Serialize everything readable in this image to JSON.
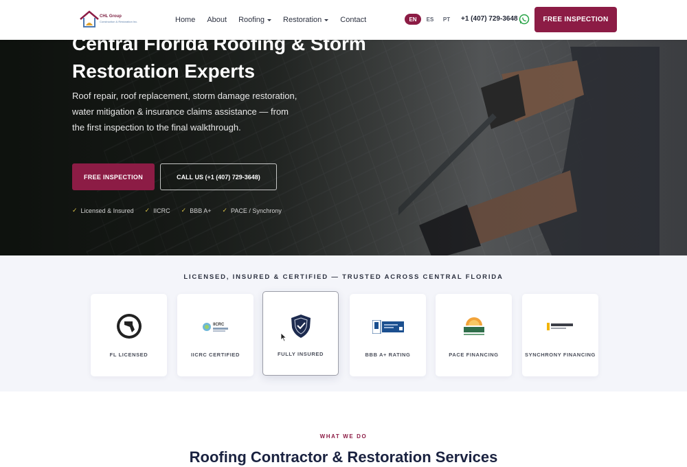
{
  "brand": {
    "logo_name": "CHL Group",
    "logo_subtitle": "Construction & Restoration Inc.",
    "primary_color": "#8c1c45"
  },
  "nav": {
    "items": [
      {
        "label": "Home",
        "has_dropdown": false
      },
      {
        "label": "About",
        "has_dropdown": false
      },
      {
        "label": "Roofing",
        "has_dropdown": true
      },
      {
        "label": "Restoration",
        "has_dropdown": true
      },
      {
        "label": "Contact",
        "has_dropdown": false
      }
    ]
  },
  "languages": {
    "options": [
      "EN",
      "ES",
      "PT"
    ],
    "selected": "EN"
  },
  "header": {
    "phone": "+1 (407) 729-3648",
    "whatsapp_icon": "whatsapp-icon",
    "cta_label": "FREE INSPECTION"
  },
  "hero": {
    "title": "Central Florida Roofing & Storm Restoration Experts",
    "subtitle": "Roof repair, roof replacement, storm damage restoration, water mitigation & insurance claims assistance — from the first inspection to the final walkthrough.",
    "primary_cta": "FREE INSPECTION",
    "secondary_cta": "CALL US (+1 (407) 729-3648)",
    "badges": [
      "Licensed & Insured",
      "IICRC",
      "BBB A+",
      "PACE / Synchrony"
    ]
  },
  "trust": {
    "heading": "LICENSED, INSURED & CERTIFIED — TRUSTED ACROSS CENTRAL FLORIDA",
    "cards": [
      {
        "label": "FL LICENSED",
        "icon": "florida-seal-icon"
      },
      {
        "label": "IICRC CERTIFIED",
        "icon": "iicrc-logo-icon"
      },
      {
        "label": "FULLY INSURED",
        "icon": "insured-shield-icon"
      },
      {
        "label": "BBB A+ RATING",
        "icon": "bbb-logo-icon"
      },
      {
        "label": "PACE FINANCING",
        "icon": "pace-logo-icon"
      },
      {
        "label": "SYNCHRONY FINANCING",
        "icon": "synchrony-logo-icon"
      }
    ]
  },
  "services": {
    "eyebrow": "WHAT WE DO",
    "title": "Roofing Contractor & Restoration Services"
  }
}
